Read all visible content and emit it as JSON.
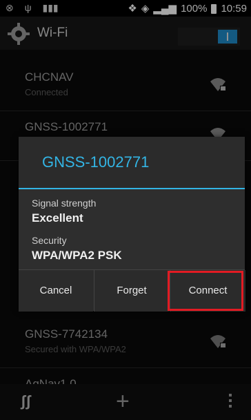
{
  "status_bar": {
    "left_icons": [
      "cyclops-icon",
      "usb-icon",
      "barcode-icon"
    ],
    "battery_percent": "100%",
    "time": "10:59"
  },
  "action_bar": {
    "title": "Wi-Fi",
    "toggle_on": true
  },
  "networks": [
    {
      "name": "CHCNAV",
      "status": "Connected"
    },
    {
      "name": "GNSS-1002771",
      "status": ""
    },
    {
      "name": "GNSS-7742134",
      "status": "Secured with WPA/WPA2"
    },
    {
      "name": "AgNav1.0",
      "status": ""
    }
  ],
  "dialog": {
    "title": "GNSS-1002771",
    "signal_label": "Signal strength",
    "signal_value": "Excellent",
    "security_label": "Security",
    "security_value": "WPA/WPA2 PSK",
    "buttons": {
      "cancel": "Cancel",
      "forget": "Forget",
      "connect": "Connect"
    }
  },
  "colors": {
    "accent": "#33b5e5",
    "highlight": "#e21b23"
  }
}
